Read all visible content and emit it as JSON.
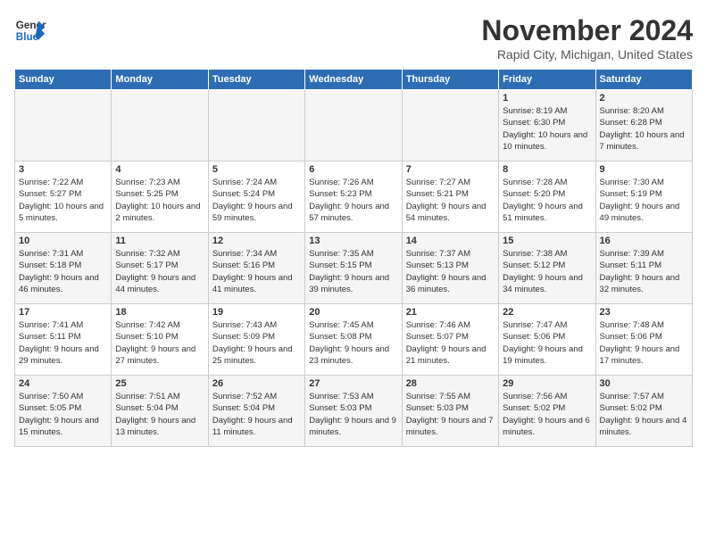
{
  "logo": {
    "line1": "General",
    "line2": "Blue"
  },
  "title": "November 2024",
  "subtitle": "Rapid City, Michigan, United States",
  "days_of_week": [
    "Sunday",
    "Monday",
    "Tuesday",
    "Wednesday",
    "Thursday",
    "Friday",
    "Saturday"
  ],
  "weeks": [
    [
      {
        "day": "",
        "info": ""
      },
      {
        "day": "",
        "info": ""
      },
      {
        "day": "",
        "info": ""
      },
      {
        "day": "",
        "info": ""
      },
      {
        "day": "",
        "info": ""
      },
      {
        "day": "1",
        "info": "Sunrise: 8:19 AM\nSunset: 6:30 PM\nDaylight: 10 hours and 10 minutes."
      },
      {
        "day": "2",
        "info": "Sunrise: 8:20 AM\nSunset: 6:28 PM\nDaylight: 10 hours and 7 minutes."
      }
    ],
    [
      {
        "day": "3",
        "info": "Sunrise: 7:22 AM\nSunset: 5:27 PM\nDaylight: 10 hours and 5 minutes."
      },
      {
        "day": "4",
        "info": "Sunrise: 7:23 AM\nSunset: 5:25 PM\nDaylight: 10 hours and 2 minutes."
      },
      {
        "day": "5",
        "info": "Sunrise: 7:24 AM\nSunset: 5:24 PM\nDaylight: 9 hours and 59 minutes."
      },
      {
        "day": "6",
        "info": "Sunrise: 7:26 AM\nSunset: 5:23 PM\nDaylight: 9 hours and 57 minutes."
      },
      {
        "day": "7",
        "info": "Sunrise: 7:27 AM\nSunset: 5:21 PM\nDaylight: 9 hours and 54 minutes."
      },
      {
        "day": "8",
        "info": "Sunrise: 7:28 AM\nSunset: 5:20 PM\nDaylight: 9 hours and 51 minutes."
      },
      {
        "day": "9",
        "info": "Sunrise: 7:30 AM\nSunset: 5:19 PM\nDaylight: 9 hours and 49 minutes."
      }
    ],
    [
      {
        "day": "10",
        "info": "Sunrise: 7:31 AM\nSunset: 5:18 PM\nDaylight: 9 hours and 46 minutes."
      },
      {
        "day": "11",
        "info": "Sunrise: 7:32 AM\nSunset: 5:17 PM\nDaylight: 9 hours and 44 minutes."
      },
      {
        "day": "12",
        "info": "Sunrise: 7:34 AM\nSunset: 5:16 PM\nDaylight: 9 hours and 41 minutes."
      },
      {
        "day": "13",
        "info": "Sunrise: 7:35 AM\nSunset: 5:15 PM\nDaylight: 9 hours and 39 minutes."
      },
      {
        "day": "14",
        "info": "Sunrise: 7:37 AM\nSunset: 5:13 PM\nDaylight: 9 hours and 36 minutes."
      },
      {
        "day": "15",
        "info": "Sunrise: 7:38 AM\nSunset: 5:12 PM\nDaylight: 9 hours and 34 minutes."
      },
      {
        "day": "16",
        "info": "Sunrise: 7:39 AM\nSunset: 5:11 PM\nDaylight: 9 hours and 32 minutes."
      }
    ],
    [
      {
        "day": "17",
        "info": "Sunrise: 7:41 AM\nSunset: 5:11 PM\nDaylight: 9 hours and 29 minutes."
      },
      {
        "day": "18",
        "info": "Sunrise: 7:42 AM\nSunset: 5:10 PM\nDaylight: 9 hours and 27 minutes."
      },
      {
        "day": "19",
        "info": "Sunrise: 7:43 AM\nSunset: 5:09 PM\nDaylight: 9 hours and 25 minutes."
      },
      {
        "day": "20",
        "info": "Sunrise: 7:45 AM\nSunset: 5:08 PM\nDaylight: 9 hours and 23 minutes."
      },
      {
        "day": "21",
        "info": "Sunrise: 7:46 AM\nSunset: 5:07 PM\nDaylight: 9 hours and 21 minutes."
      },
      {
        "day": "22",
        "info": "Sunrise: 7:47 AM\nSunset: 5:06 PM\nDaylight: 9 hours and 19 minutes."
      },
      {
        "day": "23",
        "info": "Sunrise: 7:48 AM\nSunset: 5:06 PM\nDaylight: 9 hours and 17 minutes."
      }
    ],
    [
      {
        "day": "24",
        "info": "Sunrise: 7:50 AM\nSunset: 5:05 PM\nDaylight: 9 hours and 15 minutes."
      },
      {
        "day": "25",
        "info": "Sunrise: 7:51 AM\nSunset: 5:04 PM\nDaylight: 9 hours and 13 minutes."
      },
      {
        "day": "26",
        "info": "Sunrise: 7:52 AM\nSunset: 5:04 PM\nDaylight: 9 hours and 11 minutes."
      },
      {
        "day": "27",
        "info": "Sunrise: 7:53 AM\nSunset: 5:03 PM\nDaylight: 9 hours and 9 minutes."
      },
      {
        "day": "28",
        "info": "Sunrise: 7:55 AM\nSunset: 5:03 PM\nDaylight: 9 hours and 7 minutes."
      },
      {
        "day": "29",
        "info": "Sunrise: 7:56 AM\nSunset: 5:02 PM\nDaylight: 9 hours and 6 minutes."
      },
      {
        "day": "30",
        "info": "Sunrise: 7:57 AM\nSunset: 5:02 PM\nDaylight: 9 hours and 4 minutes."
      }
    ]
  ]
}
